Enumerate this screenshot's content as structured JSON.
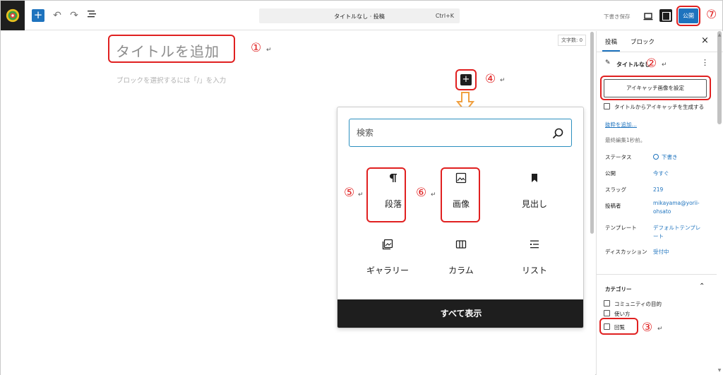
{
  "topbar": {
    "command_bar_title": "タイトルなし · 投稿",
    "command_bar_shortcut": "Ctrl+K",
    "save_draft": "下書き保存",
    "publish": "公開"
  },
  "editor": {
    "word_count": "文字数: 0",
    "title_placeholder": "タイトルを追加",
    "block_placeholder": "ブロックを選択するには「/」を入力"
  },
  "inserter": {
    "search_placeholder": "検索",
    "blocks": [
      {
        "label": "段落",
        "icon": "paragraph-icon"
      },
      {
        "label": "画像",
        "icon": "image-icon"
      },
      {
        "label": "見出し",
        "icon": "heading-icon"
      },
      {
        "label": "ギャラリー",
        "icon": "gallery-icon"
      },
      {
        "label": "カラム",
        "icon": "columns-icon"
      },
      {
        "label": "リスト",
        "icon": "list-icon"
      }
    ],
    "show_all": "すべて表示"
  },
  "sidebar": {
    "tabs": [
      "投稿",
      "ブロック"
    ],
    "post_title": "タイトルなし",
    "featured_image_button": "アイキャッチ画像を設定",
    "generate_featured_checkbox": "タイトルからアイキャッチを生成する",
    "add_excerpt": "抜粋を追加…",
    "last_edited": "最終編集1秒前。",
    "meta": [
      {
        "label": "ステータス",
        "value": "下書き"
      },
      {
        "label": "公開",
        "value": "今すぐ"
      },
      {
        "label": "スラッグ",
        "value": "219"
      },
      {
        "label": "投稿者",
        "value": "mikayama@yorii-ohsato"
      },
      {
        "label": "テンプレート",
        "value": "デフォルトテンプレート"
      },
      {
        "label": "ディスカッション",
        "value": "受付中"
      }
    ],
    "categories_title": "カテゴリー",
    "categories": [
      "コミュニティの目的",
      "使い方",
      "回覧"
    ]
  },
  "annotations": {
    "n1": "①",
    "n2": "②",
    "n3": "③",
    "n4": "④",
    "n5": "⑤",
    "n6": "⑥",
    "n7": "⑦",
    "return_mark": "↵"
  },
  "colors": {
    "accent": "#1e73be",
    "annotation_red": "#e02020",
    "dark": "#1e1e1e",
    "search_border": "#2b8fbf",
    "arrow_orange": "#f0a040"
  }
}
